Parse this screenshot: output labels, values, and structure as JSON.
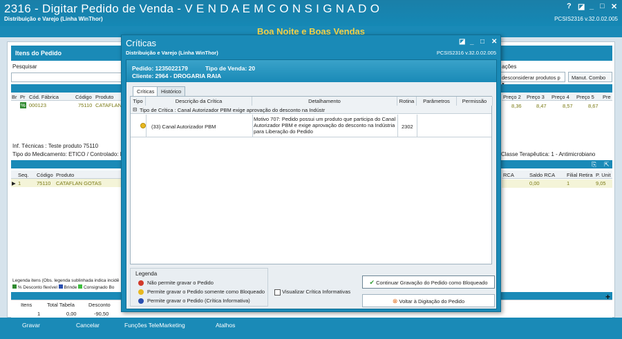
{
  "main": {
    "title": "2316 - Digitar Pedido de Venda - V E N D A   E M   C O N S I G N A D O",
    "subtitle": "Distribuição e Varejo (Linha WinThor)",
    "version": "PCSIS2316  v.32.0.02.005",
    "greeting": "Boa Noite e Boas Vendas",
    "section_items": "Itens do Pedido",
    "search_label": "Pesquisar",
    "options_label": "ações",
    "filter_select": "desconsiderar produtos p",
    "manut_button": "Manut. Combo",
    "grid1_headers": [
      "Br",
      "Pr",
      "Cód. Fábrica",
      "Código",
      "Produto"
    ],
    "grid1_row": {
      "pr": "%",
      "cod_fabrica": "000123",
      "codigo": "75110",
      "produto": "CATAFLAN"
    },
    "price_headers": [
      "Preço 2",
      "Preço 3",
      "Preço 4",
      "Preço 5",
      "Pre"
    ],
    "price_values": [
      "8,36",
      "8,47",
      "8,57",
      "8,67"
    ],
    "inf_tecnicas": "Inf. Técnicas : Teste produto 75110",
    "tipo_medicamento": "Tipo do Medicamento: ETICO / Controlado: Nã",
    "classe_terapeutica": "Classe Terapêutica: 1 - Antimicrobiano",
    "grid2_headers": [
      "Seq.",
      "Código",
      "Produto"
    ],
    "grid2_row": {
      "seq": "1",
      "codigo": "75110",
      "produto": "CATAFLAN GOTAS"
    },
    "grid2_right_headers": [
      "RCA",
      "Saldo RCA",
      "Filial Retira",
      "P. Unit"
    ],
    "grid2_right_values": [
      "0,00",
      "1",
      "9,05"
    ],
    "legend_title": "Legenda itens (Obs. legenda sublinhada indica incidê",
    "legend_items": [
      "% Desconto flexível",
      "Brinde",
      "Consignado",
      "Bo"
    ],
    "totals_headers": [
      "Itens",
      "Total Tabela",
      "Desconto"
    ],
    "totals_values": [
      "1",
      "0,00",
      "-90,50"
    ],
    "bottom_buttons": [
      "Gravar",
      "Cancelar",
      "Funções TeleMarketing",
      "Atalhos"
    ]
  },
  "modal": {
    "title": "Críticas",
    "subtitle": "Distribuição e Varejo (Linha WinThor)",
    "version": "PCSIS2316  v.32.0.02.005",
    "pedido": "Pedido: 1235022179",
    "tipo_venda": "Tipo de Venda: 20",
    "cliente": "Cliente: 2964 - DROGARIA RAIA",
    "tabs": [
      "Críticas",
      "Histórico"
    ],
    "columns": [
      "Tipo",
      "Descrição da Crítica",
      "Detalhamento",
      "Rotina",
      "Parâmetros",
      "Permissão"
    ],
    "group_label": "Tipo de Crítica : Canal Autorizador PBM exige aprovação do desconto na Indústr",
    "row": {
      "descricao": "(33) Canal Autorizador PBM",
      "detalhamento_lines": [
        "Motivo 707: Pedido possui um produto que participa do Canal",
        "Autorizador PBM e exige aprovação do desconto na Indústria",
        "para Liberação do Pedido"
      ],
      "rotina": "2302"
    },
    "legend_title": "Legenda",
    "legend": [
      {
        "text": "Não permite gravar o Pedido",
        "color": "#d23a2a"
      },
      {
        "text": "Permite gravar o Pedido somente como Bloqueado",
        "color": "#e8b820"
      },
      {
        "text": "Permite gravar o Pedido (Crítica Informativa)",
        "color": "#2a4fb0"
      }
    ],
    "checkbox_label": "Visualizar Crítica Informativas",
    "btn_continue": "Continuar Gravação do Pedido como Bloqueado",
    "btn_back": "Voltar à Digitação do Pedido"
  }
}
